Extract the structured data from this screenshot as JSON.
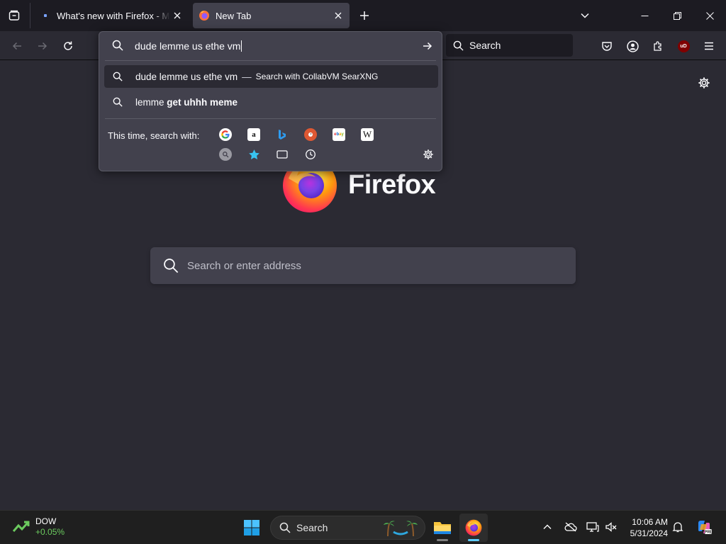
{
  "tabs": [
    {
      "title": "What's new with Firefox - More",
      "active": false
    },
    {
      "title": "New Tab",
      "active": true
    }
  ],
  "navbar": {
    "search_label": "Search",
    "addon_badge": "uD"
  },
  "urlbar": {
    "value": "dude lemme us ethe vm",
    "results": [
      {
        "text": "dude lemme us ethe vm",
        "separator": "—",
        "action": "Search with CollabVM SearXNG",
        "selected": true
      },
      {
        "text_plain": "lemme ",
        "text_bold": "get uhhh meme",
        "selected": false
      }
    ],
    "oneoff_label": "This time, search with:",
    "engines": [
      "google-icon",
      "amazon-icon",
      "bing-icon",
      "duckduckgo-icon",
      "ebay-icon",
      "wikipedia-icon",
      "searxng-icon",
      "bookmarks-icon",
      "tabs-icon",
      "history-icon"
    ]
  },
  "newtab": {
    "brand": "Firefox",
    "search_placeholder": "Search or enter address"
  },
  "taskbar": {
    "widget_name": "DOW",
    "widget_value": "+0.05%",
    "search_label": "Search",
    "time": "10:06 AM",
    "date": "5/31/2024",
    "accent": "#60cdff"
  }
}
